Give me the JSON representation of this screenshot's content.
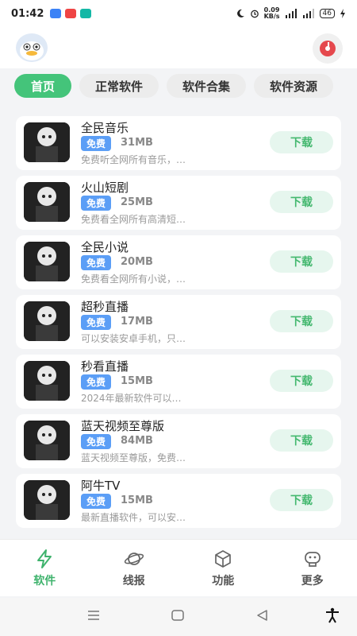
{
  "status": {
    "time": "01:42",
    "net_speed": "0.09\nKB/s",
    "battery": "46"
  },
  "tabs": [
    {
      "label": "首页",
      "active": true
    },
    {
      "label": "正常软件",
      "active": false
    },
    {
      "label": "软件合集",
      "active": false
    },
    {
      "label": "软件资源",
      "active": false
    }
  ],
  "apps": [
    {
      "title": "全民音乐",
      "badge": "免费",
      "size": "31MB",
      "desc": "免费听全网所有音乐，…",
      "button": "下载"
    },
    {
      "title": "火山短剧",
      "badge": "免费",
      "size": "25MB",
      "desc": "免费看全网所有高清短…",
      "button": "下载"
    },
    {
      "title": "全民小说",
      "badge": "免费",
      "size": "20MB",
      "desc": "免费看全网所有小说，…",
      "button": "下载"
    },
    {
      "title": "超秒直播",
      "badge": "免费",
      "size": "17MB",
      "desc": "可以安装安卓手机，只…",
      "button": "下载"
    },
    {
      "title": "秒看直播",
      "badge": "免费",
      "size": "15MB",
      "desc": "2024年最新软件可以…",
      "button": "下载"
    },
    {
      "title": "蓝天视频至尊版",
      "badge": "免费",
      "size": "84MB",
      "desc": "蓝天视频至尊版，免费…",
      "button": "下载"
    },
    {
      "title": "阿牛TV",
      "badge": "免费",
      "size": "15MB",
      "desc": "最新直播软件，可以安…",
      "button": "下载"
    }
  ],
  "bottom_nav": [
    {
      "label": "软件",
      "icon": "lightning-icon",
      "active": true
    },
    {
      "label": "线报",
      "icon": "planet-icon",
      "active": false
    },
    {
      "label": "功能",
      "icon": "cube-icon",
      "active": false
    },
    {
      "label": "更多",
      "icon": "robot-icon",
      "active": false
    }
  ],
  "colors": {
    "accent": "#44c47a",
    "badge": "#5b9ef6",
    "download_bg": "#e6f6ee"
  }
}
